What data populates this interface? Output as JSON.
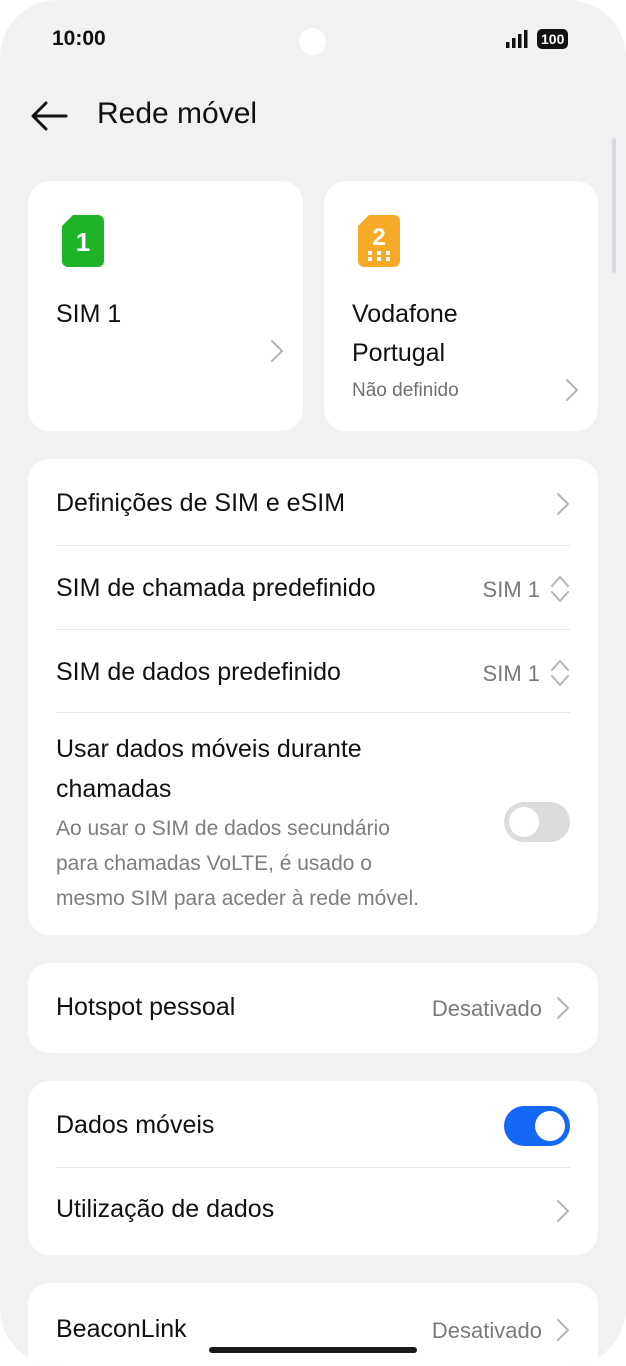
{
  "status_bar": {
    "time": "10:00",
    "battery": "100",
    "signal_icon": "signal-bars-icon"
  },
  "header": {
    "title": "Rede móvel",
    "back_icon": "arrow-left-icon"
  },
  "sim_cards": [
    {
      "badge": "1",
      "badge_color": "#1fb427",
      "name": "SIM 1",
      "subtitle": ""
    },
    {
      "badge": "2",
      "badge_color": "#f7a928",
      "name_line1": "Vodafone",
      "name_line2": "Portugal",
      "subtitle": "Não definido"
    }
  ],
  "sim_settings": {
    "sim_esim_settings": "Definições de SIM e eSIM",
    "default_call_sim": {
      "label": "SIM de chamada predefinido",
      "value": "SIM 1"
    },
    "default_data_sim": {
      "label": "SIM de dados predefinido",
      "value": "SIM 1"
    },
    "data_during_calls": {
      "title_line1": "Usar dados móveis durante",
      "title_line2": "chamadas",
      "desc_line1": "Ao usar o SIM de dados secundário",
      "desc_line2": "para chamadas VoLTE, é usado o",
      "desc_line3": "mesmo SIM para aceder à rede móvel.",
      "enabled": false
    }
  },
  "hotspot": {
    "label": "Hotspot pessoal",
    "value": "Desativado"
  },
  "mobile_data": {
    "label": "Dados móveis",
    "enabled": true,
    "usage_label": "Utilização de dados"
  },
  "beaconlink": {
    "label": "BeaconLink",
    "value": "Desativado"
  },
  "colors": {
    "accent": "#1368f5",
    "background": "#f0f1f3",
    "card": "#ffffff"
  }
}
